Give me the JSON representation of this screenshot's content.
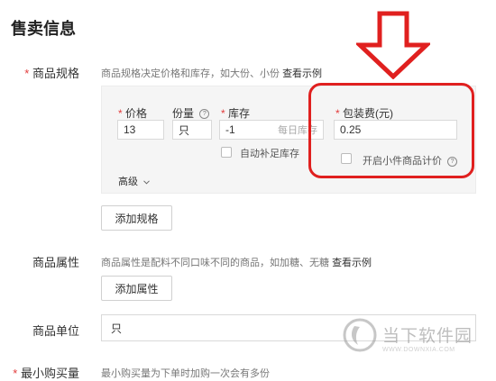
{
  "section_title": "售卖信息",
  "spec": {
    "required_mark": "*",
    "label": "商品规格",
    "hint": "商品规格决定价格和库存，如大份、小份",
    "hint_link": "查看示例",
    "fields": {
      "price": {
        "label": "价格",
        "value": "13"
      },
      "portion": {
        "label": "份量",
        "value": "只"
      },
      "stock": {
        "label": "库存",
        "value": "-1",
        "daily_placeholder": "每日库存"
      },
      "auto_restock": {
        "label": "自动补足库存",
        "checked": false
      },
      "packaging": {
        "label": "包装费(元)",
        "value": "0.25"
      },
      "small_item_pricing": {
        "label": "开启小件商品计价",
        "checked": false
      }
    },
    "advanced_label": "高级",
    "add_button": "添加规格"
  },
  "attribute": {
    "label": "商品属性",
    "hint": "商品属性是配料不同口味不同的商品，如加糖、无糖",
    "hint_link": "查看示例",
    "add_button": "添加属性"
  },
  "unit": {
    "label": "商品单位",
    "value": "只"
  },
  "min_purchase": {
    "required_mark": "*",
    "label": "最小购买量",
    "hint": "最小购买量为下单时加购一次会有多份"
  },
  "help_glyph": "?",
  "watermark": {
    "text": "当下软件园",
    "sub": "WWW.DOWNXIA.COM"
  },
  "colors": {
    "annotation_red": "#e0201f",
    "required_red": "#e23b3b"
  }
}
